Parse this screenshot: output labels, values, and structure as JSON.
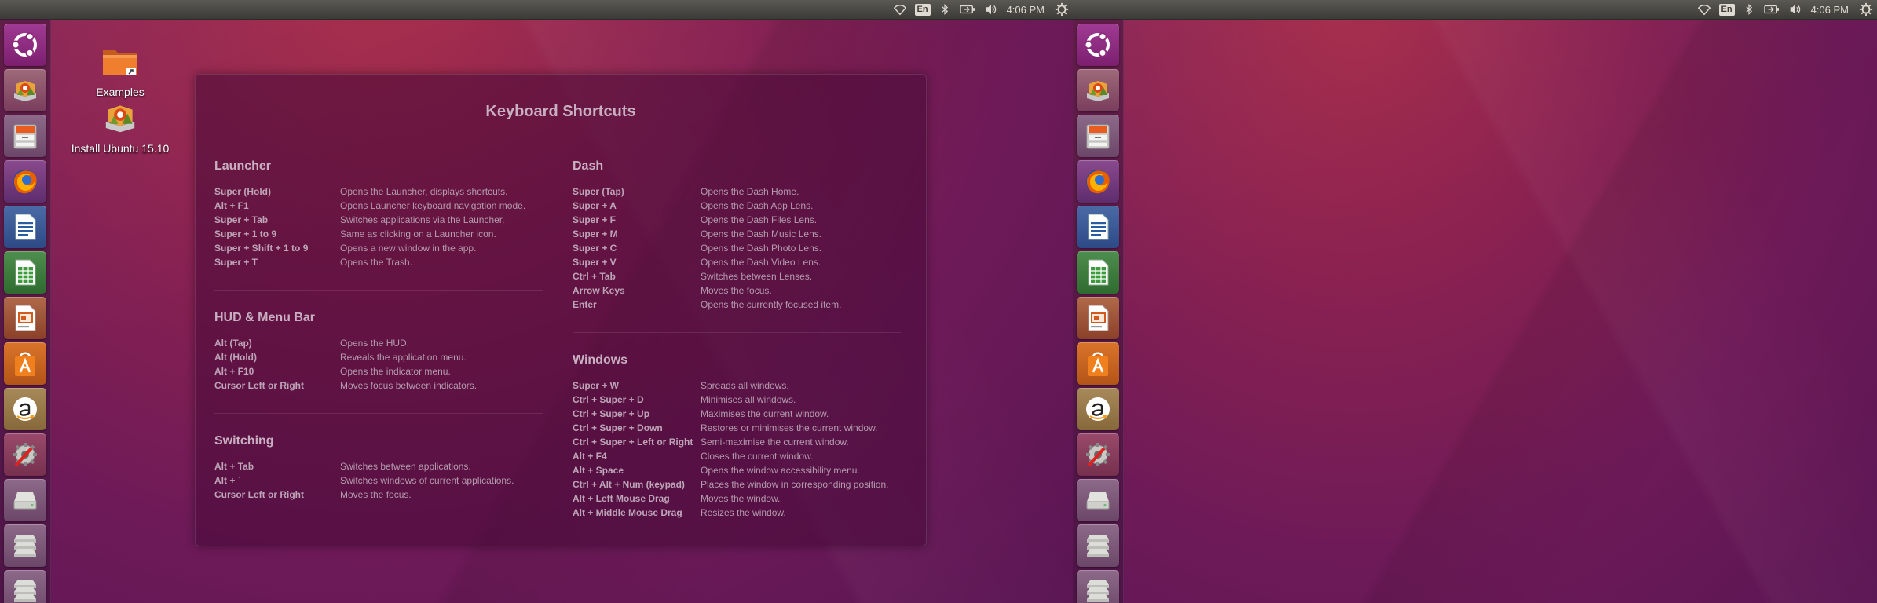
{
  "panel": {
    "keyboard_layout": "En",
    "clock": "4:06 PM",
    "indicators": [
      "wifi-icon",
      "keyboard-indicator",
      "bluetooth-icon",
      "battery-icon",
      "volume-icon",
      "clock",
      "session-gear-icon"
    ]
  },
  "launcher": {
    "items": [
      {
        "name": "dash-home",
        "icon": "ubuntu-logo-icon"
      },
      {
        "name": "install-ubuntu",
        "icon": "installer-icon"
      },
      {
        "name": "files",
        "icon": "file-cabinet-icon"
      },
      {
        "name": "firefox",
        "icon": "firefox-icon"
      },
      {
        "name": "libreoffice-writer",
        "icon": "writer-doc-icon"
      },
      {
        "name": "libreoffice-calc",
        "icon": "calc-sheet-icon"
      },
      {
        "name": "libreoffice-impress",
        "icon": "impress-slides-icon"
      },
      {
        "name": "ubuntu-software",
        "icon": "shopping-bag-icon"
      },
      {
        "name": "amazon",
        "icon": "amazon-icon"
      },
      {
        "name": "system-settings",
        "icon": "settings-tools-icon"
      },
      {
        "name": "removable-drive",
        "icon": "drive-icon"
      },
      {
        "name": "workspace-switcher",
        "icon": "workspaces-icon"
      }
    ]
  },
  "desktop": {
    "icons": [
      {
        "label": "Examples",
        "icon": "folder-icon"
      },
      {
        "label": "Install Ubuntu 15.10",
        "icon": "installer-icon"
      }
    ]
  },
  "shortcuts": {
    "title": "Keyboard Shortcuts",
    "launcher": {
      "title": "Launcher",
      "rows": [
        {
          "key": "Super (Hold)",
          "desc": "Opens the Launcher, displays shortcuts."
        },
        {
          "key": "Alt + F1",
          "desc": "Opens Launcher keyboard navigation mode."
        },
        {
          "key": "Super + Tab",
          "desc": "Switches applications via the Launcher."
        },
        {
          "key": "Super + 1 to 9",
          "desc": "Same as clicking on a Launcher icon."
        },
        {
          "key": "Super + Shift + 1 to 9",
          "desc": "Opens a new window in the app."
        },
        {
          "key": "Super + T",
          "desc": "Opens the Trash."
        }
      ]
    },
    "hud": {
      "title": "HUD & Menu Bar",
      "rows": [
        {
          "key": "Alt (Tap)",
          "desc": "Opens the HUD."
        },
        {
          "key": "Alt (Hold)",
          "desc": "Reveals the application menu."
        },
        {
          "key": "Alt + F10",
          "desc": "Opens the indicator menu."
        },
        {
          "key": "Cursor Left or Right",
          "desc": "Moves focus between indicators."
        }
      ]
    },
    "switching": {
      "title": "Switching",
      "rows": [
        {
          "key": "Alt + Tab",
          "desc": "Switches between applications."
        },
        {
          "key": "Alt + `",
          "desc": "Switches windows of current applications."
        },
        {
          "key": "Cursor Left or Right",
          "desc": "Moves the focus."
        }
      ]
    },
    "dash": {
      "title": "Dash",
      "rows": [
        {
          "key": "Super (Tap)",
          "desc": "Opens the Dash Home."
        },
        {
          "key": "Super + A",
          "desc": "Opens the Dash App Lens."
        },
        {
          "key": "Super + F",
          "desc": "Opens the Dash Files Lens."
        },
        {
          "key": "Super + M",
          "desc": "Opens the Dash Music Lens."
        },
        {
          "key": "Super + C",
          "desc": "Opens the Dash Photo Lens."
        },
        {
          "key": "Super + V",
          "desc": "Opens the Dash Video Lens."
        },
        {
          "key": "Ctrl + Tab",
          "desc": "Switches between Lenses."
        },
        {
          "key": "Arrow Keys",
          "desc": "Moves the focus."
        },
        {
          "key": "Enter",
          "desc": "Opens the currently focused item."
        }
      ]
    },
    "windows": {
      "title": "Windows",
      "rows": [
        {
          "key": "Super + W",
          "desc": "Spreads all windows."
        },
        {
          "key": "Ctrl + Super + D",
          "desc": "Minimises all windows."
        },
        {
          "key": "Ctrl + Super + Up",
          "desc": "Maximises the current window."
        },
        {
          "key": "Ctrl + Super + Down",
          "desc": "Restores or minimises the current window."
        },
        {
          "key": "Ctrl + Super + Left or Right",
          "desc": "Semi-maximise the current window."
        },
        {
          "key": "Alt + F4",
          "desc": "Closes the current window."
        },
        {
          "key": "Alt + Space",
          "desc": "Opens the window accessibility menu."
        },
        {
          "key": "Ctrl + Alt + Num (keypad)",
          "desc": "Places the window in corresponding position."
        },
        {
          "key": "Alt + Left Mouse Drag",
          "desc": "Moves the window."
        },
        {
          "key": "Alt + Middle Mouse Drag",
          "desc": "Resizes the window."
        }
      ]
    }
  }
}
